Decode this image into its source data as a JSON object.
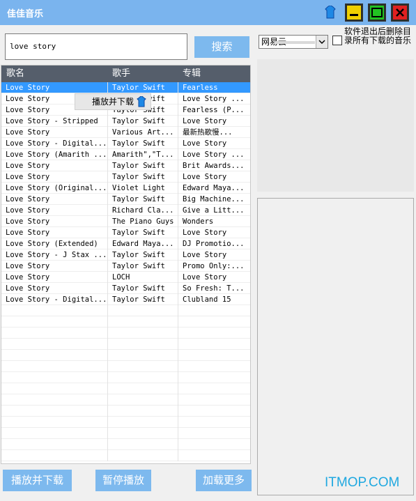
{
  "window": {
    "title": "佳佳音乐"
  },
  "search": {
    "query": "love story",
    "button_label": "搜索"
  },
  "source": {
    "selected": "网易云"
  },
  "option": {
    "label": "软件退出后删除目录所有下载的音乐"
  },
  "table": {
    "headers": [
      "歌名",
      "歌手",
      "专辑"
    ],
    "rows": [
      [
        "Love Story",
        "Taylor Swift",
        "Fearless"
      ],
      [
        "Love Story",
        "Taylor Swift",
        "Love Story ..."
      ],
      [
        "Love Story",
        "Taylor Swift",
        "Fearless (P..."
      ],
      [
        "Love Story - Stripped",
        "Taylor Swift",
        "Love Story"
      ],
      [
        "Love Story",
        "Various Art...",
        "最新热歌慢..."
      ],
      [
        "Love Story - Digital...",
        "Taylor Swift",
        "Love Story"
      ],
      [
        "Love Story (Amarith ...",
        "Amarith\",\"T...",
        "Love Story ..."
      ],
      [
        "Love Story",
        "Taylor Swift",
        "Brit Awards..."
      ],
      [
        "Love Story",
        "Taylor Swift",
        "Love Story"
      ],
      [
        "Love Story (Original...",
        "Violet Light",
        "Edward Maya..."
      ],
      [
        "Love Story",
        "Taylor Swift",
        "Big Machine..."
      ],
      [
        "Love Story",
        "Richard Cla...",
        "Give a Litt..."
      ],
      [
        "Love Story",
        "The Piano Guys",
        "Wonders"
      ],
      [
        "Love Story",
        "Taylor Swift",
        "Love Story"
      ],
      [
        "Love Story  (Extended)",
        "Edward Maya...",
        "DJ Promotio..."
      ],
      [
        "Love Story - J Stax ...",
        "Taylor Swift",
        "Love Story"
      ],
      [
        "Love Story",
        "Taylor Swift",
        "Promo Only:..."
      ],
      [
        "Love Story",
        "LOCH",
        "Love Story"
      ],
      [
        "Love Story",
        "Taylor Swift",
        "So Fresh: T..."
      ],
      [
        "Love Story - Digital...",
        "Taylor Swift",
        "Clubland 15"
      ]
    ],
    "selected_index": 0
  },
  "context_menu": {
    "item": "播放并下载"
  },
  "footer": {
    "play_download": "播放并下载",
    "pause": "暂停播放",
    "load_more": "加载更多"
  },
  "watermark": "ITMOP.COM",
  "colors": {
    "titlebar": "#7ab4ee",
    "button": "#7db9ee",
    "header": "#555e6b",
    "selection": "#3399ff",
    "accent_green": "#22c322",
    "accent_yellow": "#f0d000",
    "accent_red": "#e02020"
  }
}
